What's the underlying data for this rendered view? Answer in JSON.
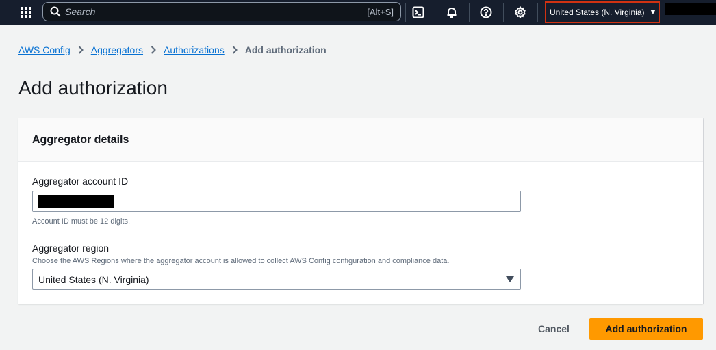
{
  "topnav": {
    "search_placeholder": "Search",
    "search_shortcut": "[Alt+S]",
    "region_label": "United States (N. Virginia)"
  },
  "icons": {
    "apps": "apps-grid-icon",
    "search": "search-icon",
    "cloudshell": "cloudshell-icon",
    "notifications": "bell-icon",
    "help": "help-icon",
    "settings": "gear-icon",
    "region_caret": "caret-down-icon"
  },
  "breadcrumb": {
    "items": [
      "AWS Config",
      "Aggregators",
      "Authorizations"
    ],
    "current": "Add authorization"
  },
  "page": {
    "title": "Add authorization"
  },
  "card": {
    "title": "Aggregator details",
    "account_id": {
      "label": "Aggregator account ID",
      "constraint": "Account ID must be 12 digits."
    },
    "region": {
      "label": "Aggregator region",
      "description": "Choose the AWS Regions where the aggregator account is allowed to collect AWS Config configuration and compliance data.",
      "selected": "United States (N. Virginia)"
    }
  },
  "actions": {
    "cancel": "Cancel",
    "submit": "Add authorization"
  },
  "colors": {
    "nav_bg": "#161e2d",
    "link": "#0972d3",
    "primary": "#ff9900",
    "highlight": "#d13212"
  }
}
